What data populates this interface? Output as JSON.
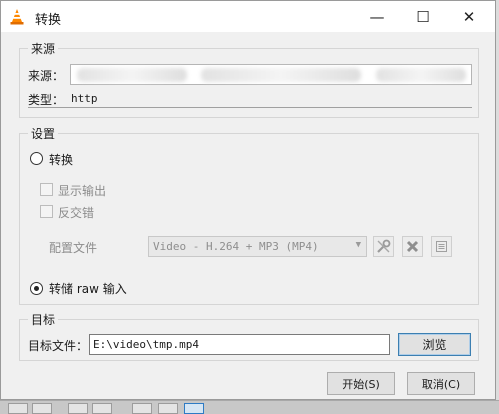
{
  "window": {
    "title": "转换",
    "minimize_glyph": "—",
    "maximize_glyph": "☐",
    "close_glyph": "✕",
    "icon": "vlc-cone-icon",
    "accent_color": "#ff8800"
  },
  "source": {
    "group_title": "来源",
    "source_label": "来源：",
    "type_label": "类型：",
    "type_value": "http"
  },
  "settings": {
    "group_title": "设置",
    "convert_label": "转换",
    "show_output_label": "显示输出",
    "deinterlace_label": "反交错",
    "profile_label": "配置文件",
    "profile_value": "Video - H.264 + MP3 (MP4)",
    "dump_raw_label": "转储 raw 输入",
    "selected_mode": "dump_raw"
  },
  "target": {
    "group_title": "目标",
    "dest_label": "目标文件：",
    "dest_value": "E:\\video\\tmp.mp4",
    "browse_label": "浏览"
  },
  "footer": {
    "start_label": "开始(S)",
    "cancel_label": "取消(C)"
  }
}
